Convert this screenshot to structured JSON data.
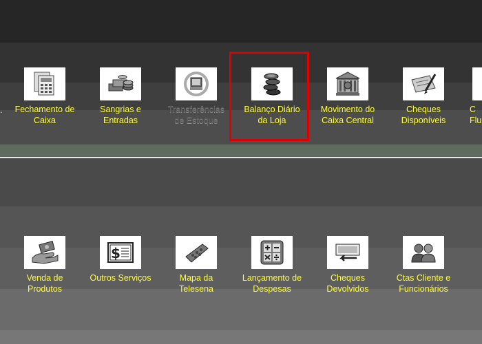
{
  "colors": {
    "label": "#ffff33",
    "disabled_label": "#5c5c5c",
    "highlight": "#e00000"
  },
  "row1": {
    "partial_left": ".",
    "partial_right": "C\nFlu",
    "items": [
      {
        "label": "Fechamento de\nCaixa",
        "icon": "calculator-documents-icon"
      },
      {
        "label": "Sangrias e\nEntradas",
        "icon": "cash-stacks-icon"
      },
      {
        "label": "Transferências\nde Estoque",
        "icon": "transfer-computer-icon"
      },
      {
        "label": "Balanço Diário\nda Loja",
        "icon": "coin-stack-icon"
      },
      {
        "label": "Movimento do\nCaixa Central",
        "icon": "bank-building-icon"
      },
      {
        "label": "Cheques\nDisponíveis",
        "icon": "checkbook-pen-icon"
      }
    ]
  },
  "row2": {
    "items": [
      {
        "label": "Venda de\nProdutos",
        "icon": "hand-money-icon"
      },
      {
        "label": "Outros Serviços",
        "icon": "dollar-bill-icon"
      },
      {
        "label": "Mapa da\nTelesena",
        "icon": "ticket-map-icon"
      },
      {
        "label": "Lançamento de\nDespesas",
        "icon": "math-calculator-icon"
      },
      {
        "label": "Cheques\nDevolvidos",
        "icon": "returned-cheque-icon"
      },
      {
        "label": "Ctas Cliente e\nFuncionários",
        "icon": "people-icon"
      }
    ]
  }
}
